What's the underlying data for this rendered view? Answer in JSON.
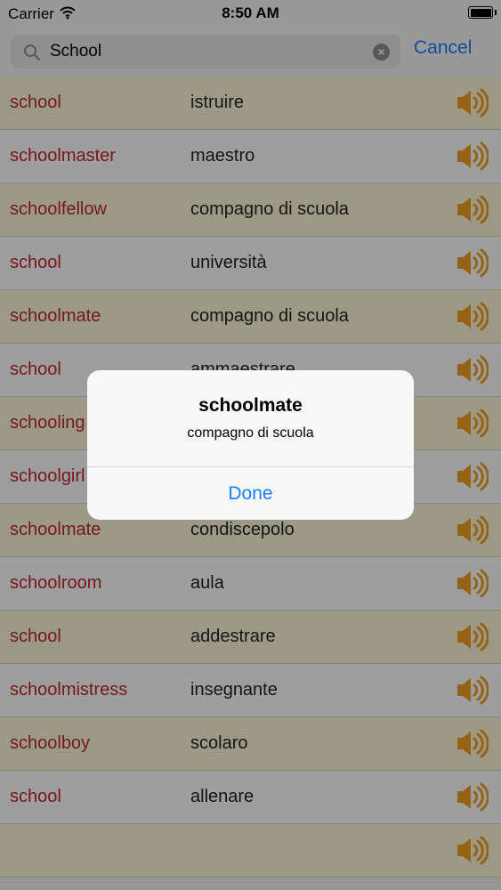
{
  "status_bar": {
    "carrier": "Carrier",
    "time": "8:50 AM"
  },
  "search": {
    "query": "School",
    "cancel_label": "Cancel"
  },
  "rows": [
    {
      "word": "school",
      "translation": "istruire"
    },
    {
      "word": "schoolmaster",
      "translation": "maestro"
    },
    {
      "word": "schoolfellow",
      "translation": "compagno di scuola"
    },
    {
      "word": "school",
      "translation": "università"
    },
    {
      "word": "schoolmate",
      "translation": "compagno di scuola"
    },
    {
      "word": "school",
      "translation": "ammaestrare"
    },
    {
      "word": "schooling",
      "translation": ""
    },
    {
      "word": "schoolgirl",
      "translation": ""
    },
    {
      "word": "schoolmate",
      "translation": "condiscepolo"
    },
    {
      "word": "schoolroom",
      "translation": "aula"
    },
    {
      "word": "school",
      "translation": "addestrare"
    },
    {
      "word": "schoolmistress",
      "translation": "insegnante"
    },
    {
      "word": "schoolboy",
      "translation": "scolaro"
    },
    {
      "word": "school",
      "translation": "allenare"
    },
    {
      "word": "",
      "translation": ""
    }
  ],
  "alert": {
    "title": "schoolmate",
    "message": "compagno di scuola",
    "done_label": "Done"
  },
  "colors": {
    "accent": "#157efb",
    "word": "#c0262b",
    "row_alt": "#fcf8d8",
    "speaker": "#f0a020"
  },
  "icons": {
    "search": "search-icon",
    "clear": "clear-icon",
    "speaker": "speaker-icon",
    "wifi": "wifi-icon",
    "battery": "battery-icon"
  }
}
